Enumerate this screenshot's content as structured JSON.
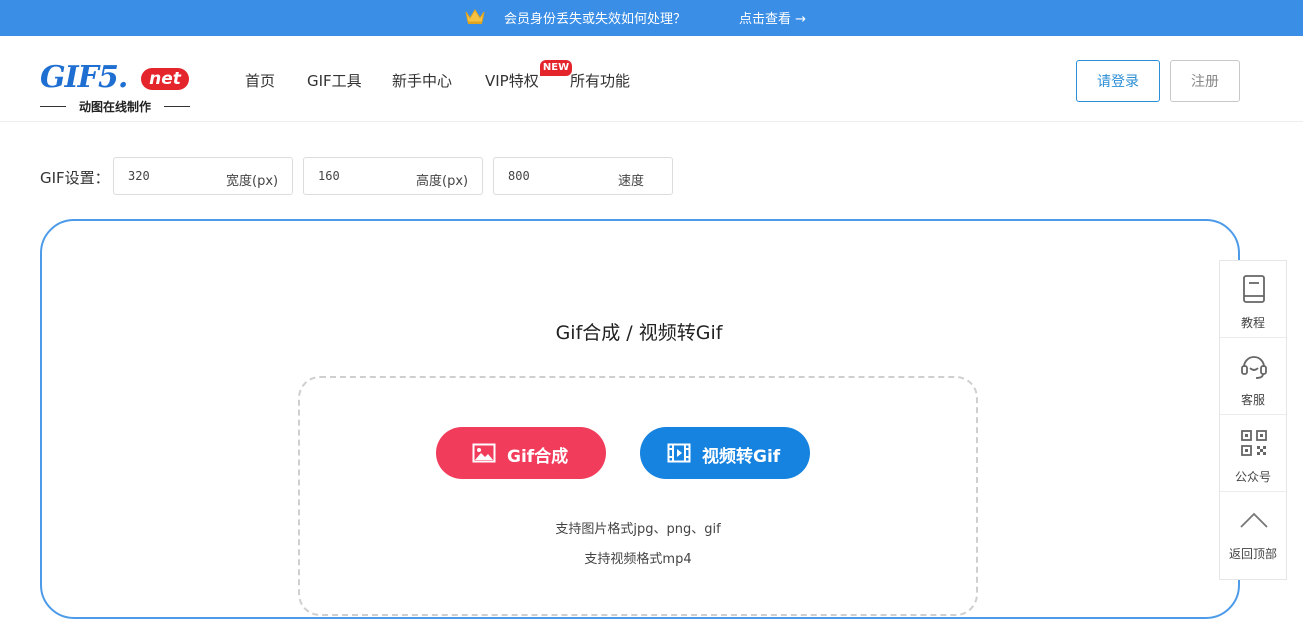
{
  "banner": {
    "message": "会员身份丢失或失效如何处理？",
    "link": "点击查看 →"
  },
  "logo": {
    "main": "GIF5.",
    "badge": "net",
    "tagline": "动图在线制作"
  },
  "nav": {
    "home": "首页",
    "tools": "GIF工具",
    "guide": "新手中心",
    "vip": "VIP特权",
    "vip_badge": "NEW",
    "all": "所有功能"
  },
  "auth": {
    "login": "请登录",
    "register": "注册"
  },
  "settings": {
    "label": "GIF设置：",
    "width": {
      "value": "320",
      "unit": "宽度(px)"
    },
    "height": {
      "value": "160",
      "unit": "高度(px)"
    },
    "speed": {
      "value": "800",
      "unit": "速度"
    }
  },
  "panel": {
    "title": "Gif合成 / 视频转Gif",
    "gif_button": "Gif合成",
    "video_button": "视频转Gif",
    "hint_images": "支持图片格式jpg、png、gif",
    "hint_video": "支持视频格式mp4"
  },
  "sidebar": {
    "items": [
      {
        "label": "教程",
        "icon": "book-icon"
      },
      {
        "label": "客服",
        "icon": "headset-icon"
      },
      {
        "label": "公众号",
        "icon": "qrcode-icon"
      },
      {
        "label": "返回顶部",
        "icon": "chevron-up-icon"
      }
    ]
  },
  "colors": {
    "banner": "#3a8ee6",
    "brand_blue": "#1e6fd1",
    "gif_button": "#f23c5c",
    "video_button": "#1683e0",
    "panel_border": "#4c9be8"
  }
}
